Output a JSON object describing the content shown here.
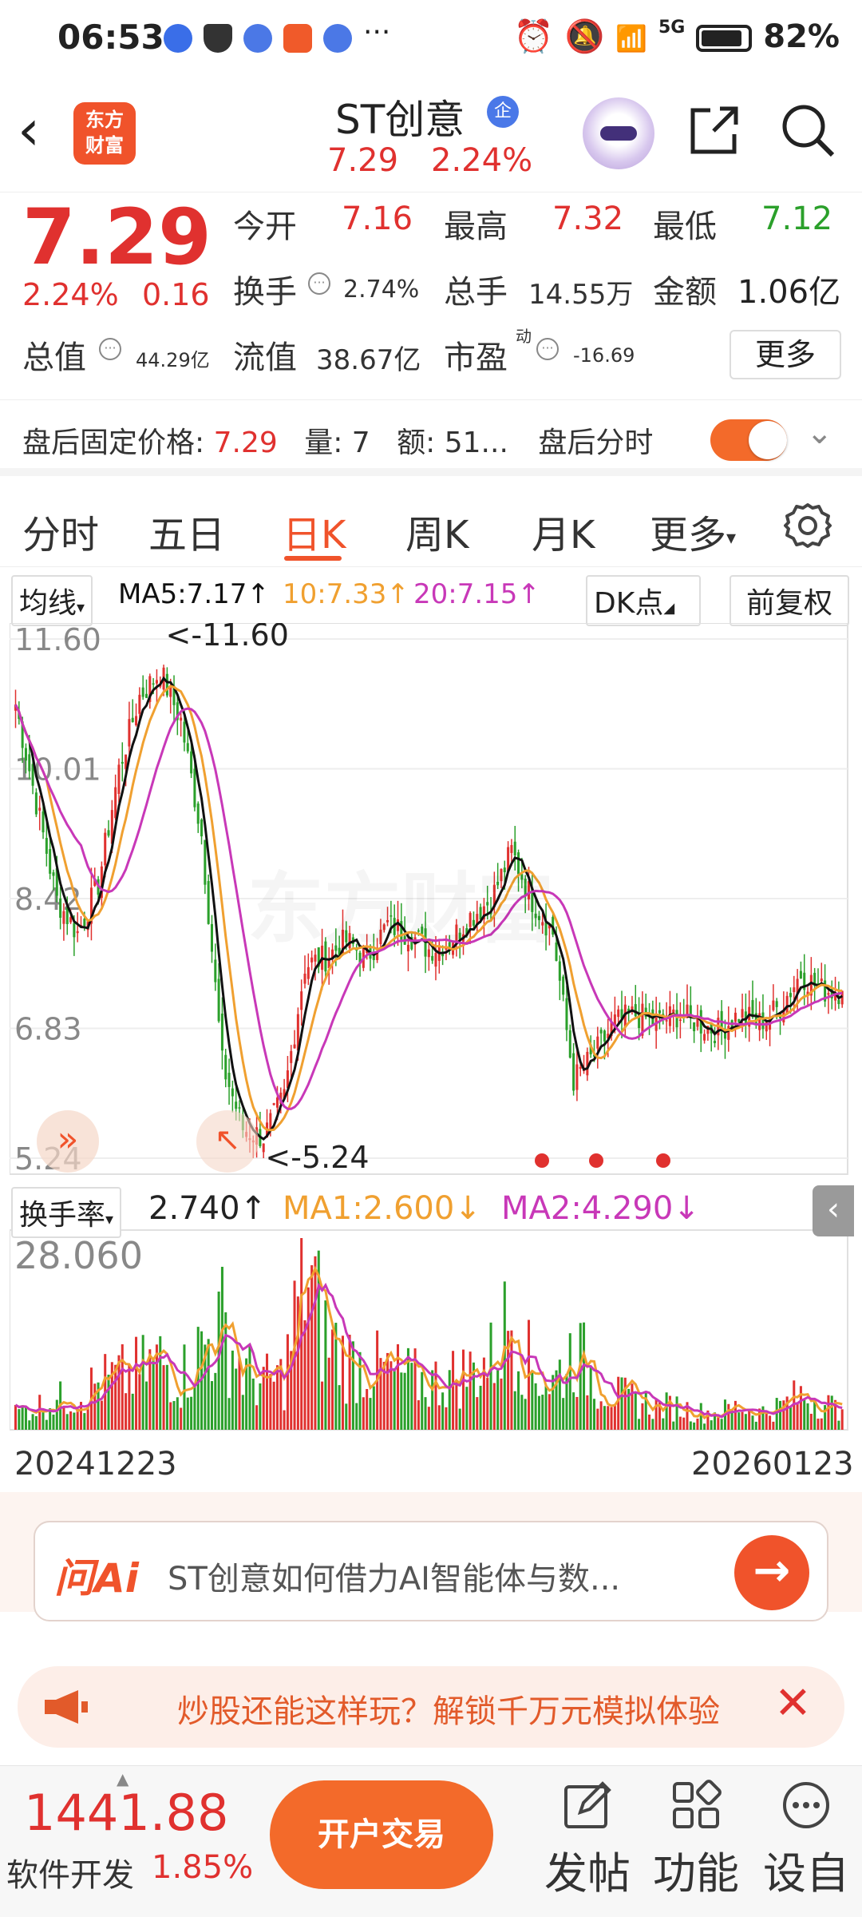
{
  "status_bar": {
    "time": "06:53",
    "battery": "82%",
    "network": "5G"
  },
  "header": {
    "title": "ST创意",
    "badge": "企",
    "price": "7.29",
    "change_pct": "2.24%",
    "logo_text_1": "东方",
    "logo_text_2": "财富"
  },
  "quote": {
    "price": "7.29",
    "change_pct": "2.24%",
    "change": "0.16",
    "open_label": "今开",
    "open": "7.16",
    "high_label": "最高",
    "high": "7.32",
    "low_label": "最低",
    "low": "7.12",
    "turnover_label": "换手",
    "turnover": "2.74%",
    "volume_label": "总手",
    "volume": "14.55万",
    "amount_label": "金额",
    "amount": "1.06亿",
    "mktcap_label": "总值",
    "mktcap": "44.29亿",
    "float_label": "流值",
    "float": "38.67亿",
    "pe_label": "市盈",
    "pe_sup": "动",
    "pe": "-16.69",
    "more": "更多"
  },
  "after_hours": {
    "label": "盘后固定价格:",
    "price": "7.29",
    "vol_label": "量:",
    "vol": "7",
    "amt_label": "额:",
    "amt": "51...",
    "timeshare_label": "盘后分时"
  },
  "tabs": [
    {
      "label": "分时"
    },
    {
      "label": "五日"
    },
    {
      "label": "日K"
    },
    {
      "label": "周K"
    },
    {
      "label": "月K"
    },
    {
      "label": "更多"
    }
  ],
  "ma_row": {
    "selector": "均线",
    "ma5": "MA5:7.17↑",
    "ma10": "10:7.33↑",
    "ma20": "20:7.15↑",
    "dk": "DK点",
    "adjust": "前复权"
  },
  "colors": {
    "up": "#e0312f",
    "down": "#2ba02b",
    "ma5": "#111111",
    "ma10": "#f0a030",
    "ma20": "#c838b8",
    "accent": "#f0532b"
  },
  "chart_data": [
    {
      "type": "candlestick",
      "y_ticks": [
        "11.60",
        "10.01",
        "8.42",
        "6.83",
        "5.24"
      ],
      "ylim": [
        5.24,
        11.6
      ],
      "max_label": "<-11.60",
      "min_label": "<-5.24",
      "approx_close": [
        10.8,
        9.6,
        8.4,
        8.0,
        8.6,
        10.0,
        10.9,
        11.2,
        10.6,
        9.2,
        6.4,
        5.6,
        5.5,
        6.0,
        7.6,
        7.7,
        7.9,
        7.7,
        8.1,
        8.0,
        7.8,
        7.9,
        8.2,
        8.4,
        9.0,
        8.4,
        8.0,
        6.2,
        6.5,
        6.9,
        7.0,
        6.9,
        7.0,
        6.9,
        6.8,
        7.0,
        6.9,
        7.1,
        7.5,
        7.3,
        7.29
      ]
    },
    {
      "type": "bar",
      "indicator": "换手率",
      "value": "2.740↑",
      "ma1": "MA1:2.600↓",
      "ma2": "MA2:4.290↓",
      "y_max_label": "28.060",
      "approx_values": [
        3,
        4,
        5,
        6,
        8,
        9,
        10,
        12,
        9,
        14,
        18,
        10,
        8,
        9,
        28,
        16,
        12,
        11,
        10,
        9,
        8,
        9,
        10,
        12,
        20,
        10,
        8,
        14,
        9,
        6,
        5,
        4,
        4,
        3,
        3,
        4,
        3,
        4,
        6,
        5,
        3
      ]
    }
  ],
  "dates": {
    "start": "20241223",
    "end": "20260123"
  },
  "ai": {
    "logo": "问Ai",
    "text": "ST创意如何借力AI智能体与数..."
  },
  "promo": {
    "text": "炒股还能这样玩？解锁千万元模拟体验"
  },
  "bottom": {
    "index_value": "1441.88",
    "index_name": "软件开发",
    "index_pct": "1.85%",
    "open_account": "开户交易",
    "post": "发帖",
    "function": "功能",
    "custom": "设自"
  }
}
